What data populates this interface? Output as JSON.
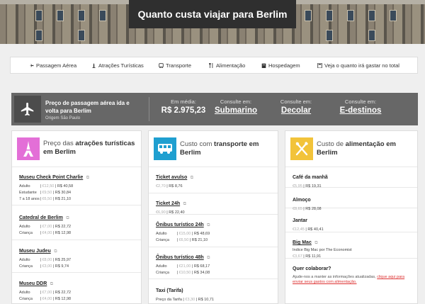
{
  "hero": {
    "title": "Quanto custa viajar para Berlim"
  },
  "nav": {
    "items": [
      {
        "label": "Passagem Aérea",
        "icon": "airplane-icon"
      },
      {
        "label": "Atrações Turísticas",
        "icon": "monument-icon"
      },
      {
        "label": "Transporte",
        "icon": "bus-icon"
      },
      {
        "label": "Alimentação",
        "icon": "cutlery-icon"
      },
      {
        "label": "Hospedagem",
        "icon": "hotel-icon"
      },
      {
        "label": "Veja o quanto irá gastar no total",
        "icon": "calculator-icon"
      }
    ]
  },
  "airfare": {
    "title": "Preço de passagem aérea ida e volta para Berlim",
    "origin": "Origem São Paulo",
    "average_caption": "Em média:",
    "average_value": "R$ 2.975,23",
    "sites": [
      {
        "caption": "Consulte em:",
        "name": "Submarino"
      },
      {
        "caption": "Consulte em:",
        "name": "Decolar"
      },
      {
        "caption": "Consulte em:",
        "name": "E-destinos"
      }
    ]
  },
  "attractions": {
    "title_prefix": "Preço das ",
    "title_bold": "atrações turísticas em Berlim",
    "items": [
      {
        "name": "Museu Check Point Charlie",
        "rows": [
          {
            "label": "Adulto",
            "old": "€12,50",
            "price": "R$ 40,58"
          },
          {
            "label": "Estudante",
            "old": "€9,50",
            "price": "R$ 30,84"
          },
          {
            "label": "7 a 18 anos",
            "old": "€6,50",
            "price": "R$ 21,10"
          }
        ]
      },
      {
        "name": "Catedral de Berlim",
        "rows": [
          {
            "label": "Adulto",
            "old": "€7,00",
            "price": "R$ 22,72"
          },
          {
            "label": "Criança",
            "old": "€4,00",
            "price": "R$ 12,98"
          }
        ]
      },
      {
        "name": "Museu Judeu",
        "rows": [
          {
            "label": "Adulto",
            "old": "€8,00",
            "price": "R$ 25,97"
          },
          {
            "label": "Criança",
            "old": "€3,00",
            "price": "R$ 9,74"
          }
        ]
      },
      {
        "name": "Museu DDR",
        "rows": [
          {
            "label": "Adulto",
            "old": "€7,00",
            "price": "R$ 22,72"
          },
          {
            "label": "Criança",
            "old": "€4,00",
            "price": "R$ 12,98"
          }
        ]
      }
    ]
  },
  "transport": {
    "title_prefix": "Custo com ",
    "title_bold": "transporte em Berlim",
    "items": [
      {
        "name": "Ticket avulso",
        "rows": [
          {
            "label": "",
            "old": "€2,70",
            "price": "R$ 8,76"
          }
        ]
      },
      {
        "name": "Ticket 24h",
        "rows": [
          {
            "label": "",
            "old": "€6,90",
            "price": "R$ 22,40"
          }
        ]
      },
      {
        "name": "Ônibus turístico 24h",
        "rows": [
          {
            "label": "Adulto",
            "old": "€15,00",
            "price": "R$ 48,69"
          },
          {
            "label": "Criança",
            "old": "€6,50",
            "price": "R$ 21,10"
          }
        ]
      },
      {
        "name": "Ônibus turístico 48h",
        "rows": [
          {
            "label": "Adulto",
            "old": "€21,00",
            "price": "R$ 68,17"
          },
          {
            "label": "Criança",
            "old": "€10,50",
            "price": "R$ 34,08"
          }
        ]
      },
      {
        "name": "Taxi (Tarifa)",
        "rows": [
          {
            "label": "Preço da Tarifa",
            "old": "€3,30",
            "price": "R$ 10,71"
          }
        ]
      }
    ]
  },
  "food": {
    "title_prefix": "Custo de ",
    "title_bold": "alimentação em Berlim",
    "items": [
      {
        "name": "Café da manhã",
        "old": "€5,95",
        "price": "R$ 19,31"
      },
      {
        "name": "Almoço",
        "old": "€8,65",
        "price": "R$ 28,08"
      },
      {
        "name": "Jantar",
        "old": "€12,45",
        "price": "R$ 40,41"
      }
    ],
    "bigmac": {
      "name": "Big Mac",
      "sub": "Indice Big Mac por The Economist",
      "old": "€3,67",
      "price": "R$ 11,91"
    },
    "contribute": {
      "title": "Quer colaborar?",
      "text": "Ajude-nos a manter as informações atualizadas, ",
      "link": "clique aqui para enviar seus gastos com alimentação."
    }
  },
  "colors": {
    "attractions": "#e36fd7",
    "transport": "#1f9fd0",
    "food": "#f2c33a",
    "bar": "#676767"
  }
}
